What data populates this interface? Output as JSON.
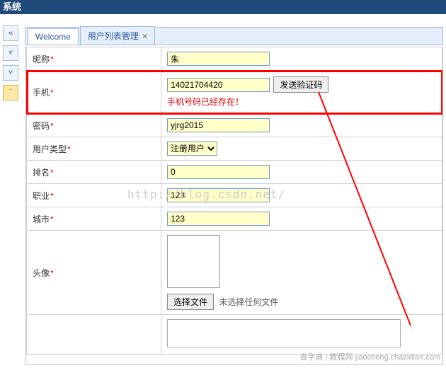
{
  "header": {
    "title": "系统"
  },
  "sidebar": {
    "collapse_icon": "«",
    "down1_icon": "˅",
    "down2_icon": "˅",
    "up_icon": "ˆ"
  },
  "tabs": {
    "items": [
      {
        "label": "Welcome",
        "closable": false,
        "active": false
      },
      {
        "label": "用户列表管理",
        "closable": true,
        "active": true
      }
    ],
    "close_glyph": "×"
  },
  "form": {
    "nickname": {
      "label": "昵称",
      "value": "朱"
    },
    "phone": {
      "label": "手机",
      "value": "14021704420",
      "send_label": "发送验证码",
      "error": "手机号码已经存在！"
    },
    "password": {
      "label": "密码",
      "value": "yjrg2015"
    },
    "usertype": {
      "label": "用户类型",
      "value": "注册用户",
      "options": [
        "注册用户"
      ]
    },
    "rank": {
      "label": "排名",
      "value": "0"
    },
    "job": {
      "label": "职业",
      "value": "123"
    },
    "city": {
      "label": "城市",
      "value": "123"
    },
    "avatar": {
      "label": "头像",
      "file_button": "选择文件",
      "file_status": "未选择任何文件"
    }
  },
  "watermark": "http://blog.csdn.net/",
  "watermark2": "查字典  | 教程网  jiaocheng.chazidian.com"
}
